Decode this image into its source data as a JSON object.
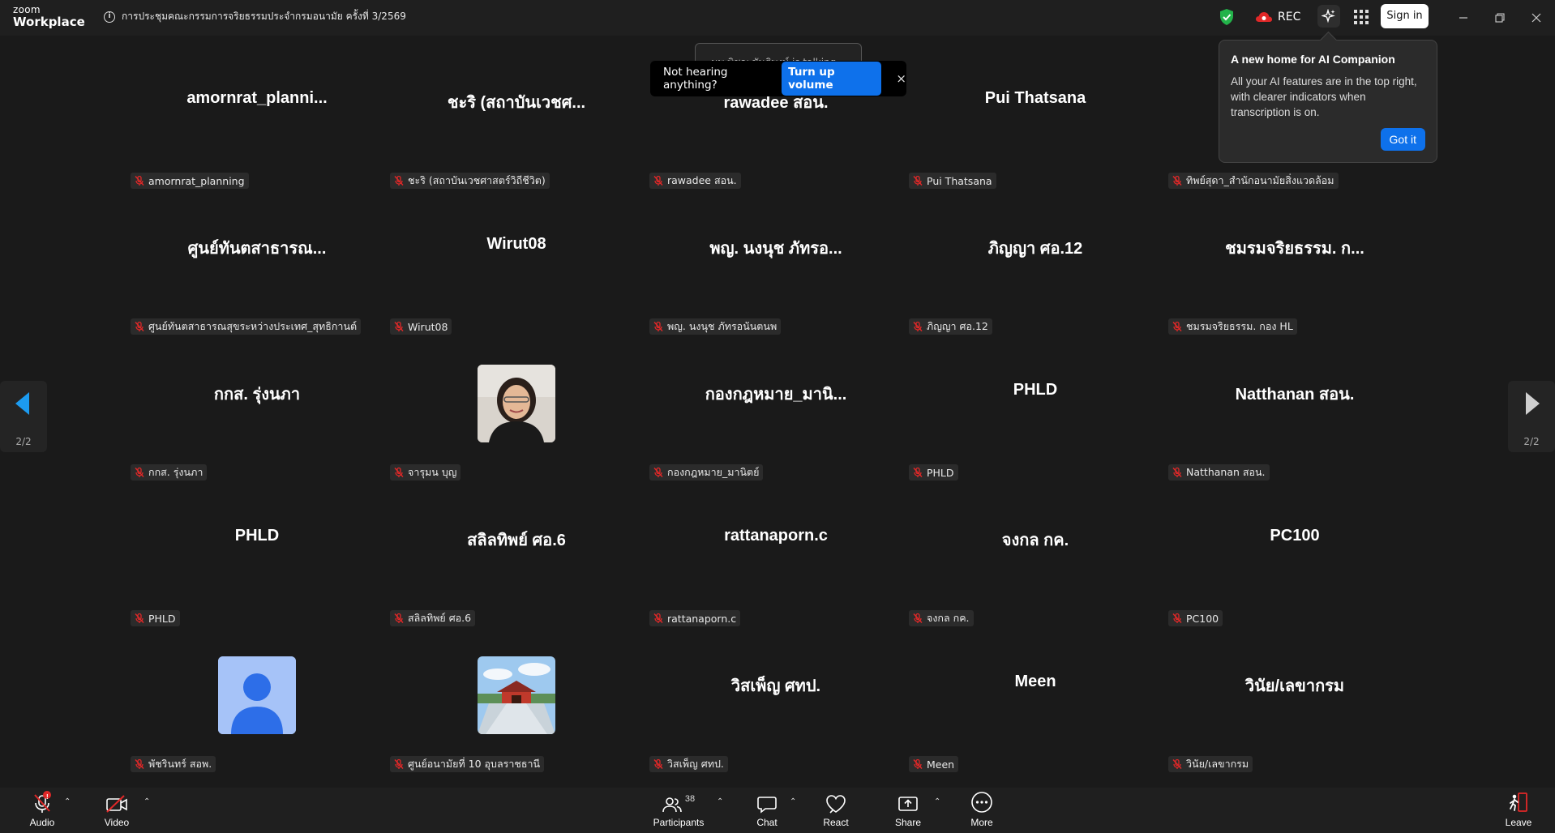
{
  "app": {
    "brand_top": "zoom",
    "brand_bottom": "Workplace"
  },
  "meeting": {
    "title": "การประชุมคณะกรรมการจริยธรรมประจำกรมอนามัย ครั้งที่ 3/2569"
  },
  "header": {
    "rec_label": "REC",
    "sign_in": "Sign in"
  },
  "talking_indicator": "นพ.พิชญ ขันติพงษ์ is talking...",
  "toast": {
    "message": "Not hearing anything?",
    "action": "Turn up volume",
    "close": "×"
  },
  "popover": {
    "title": "A new home for AI Companion",
    "body": "All your AI features are in the top right, with clearer indicators when transcription is on.",
    "button": "Got it"
  },
  "pagination": {
    "left_count": "2/2",
    "right_count": "2/2"
  },
  "participants_grid": [
    {
      "display": "amornrat_planni...",
      "label": "amornrat_planning",
      "avatar": ""
    },
    {
      "display": "ชะริ (สถาบันเวชศ...",
      "label": "ชะริ (สถาบันเวชศาสตร์วิถีชีวิต)",
      "avatar": ""
    },
    {
      "display": "rawadee  สอน.",
      "label": "rawadee  สอน.",
      "avatar": ""
    },
    {
      "display": "Pui Thatsana",
      "label": "Pui Thatsana",
      "avatar": ""
    },
    {
      "display": "",
      "label": "ทิพย์สุดา_สำนักอนามัยสิ่งแวดล้อม",
      "avatar": ""
    },
    {
      "display": "ศูนย์ทันตสาธารณ...",
      "label": "ศูนย์ทันตสาธารณสุขระหว่างประเทศ_สุทธิกานต์",
      "avatar": ""
    },
    {
      "display": "Wirut08",
      "label": "Wirut08",
      "avatar": ""
    },
    {
      "display": "พญ. นงนุช ภัทรอ...",
      "label": "พญ. นงนุช ภัทรอนันตนพ",
      "avatar": ""
    },
    {
      "display": "ภิญญา ศอ.12",
      "label": "ภิญญา ศอ.12",
      "avatar": ""
    },
    {
      "display": "ชมรมจริยธรรม. ก...",
      "label": "ชมรมจริยธรรม. กอง HL",
      "avatar": ""
    },
    {
      "display": "กกส. รุ่งนภา",
      "label": "กกส. รุ่งนภา",
      "avatar": ""
    },
    {
      "display": "",
      "label": "จารุมน บุญ",
      "avatar": "photo"
    },
    {
      "display": "กองกฎหมาย_มานิ...",
      "label": "กองกฎหมาย_มานิตย์",
      "avatar": ""
    },
    {
      "display": "PHLD",
      "label": "PHLD",
      "avatar": ""
    },
    {
      "display": "Natthanan สอน.",
      "label": "Natthanan สอน.",
      "avatar": ""
    },
    {
      "display": "PHLD",
      "label": "PHLD",
      "avatar": ""
    },
    {
      "display": "สลิลทิพย์ ศอ.6",
      "label": "สลิลทิพย์ ศอ.6",
      "avatar": ""
    },
    {
      "display": "rattanaporn.c",
      "label": "rattanaporn.c",
      "avatar": ""
    },
    {
      "display": "จงกล กค.",
      "label": "จงกล กค.",
      "avatar": ""
    },
    {
      "display": "PC100",
      "label": "PC100",
      "avatar": ""
    },
    {
      "display": "",
      "label": "พัชรินทร์ สอพ.",
      "avatar": "default"
    },
    {
      "display": "",
      "label": "ศูนย์อนามัยที่ 10 อุบลราชธานี",
      "avatar": "temple"
    },
    {
      "display": "วิสเพ็ญ ศทป.",
      "label": "วิสเพ็ญ ศทป.",
      "avatar": ""
    },
    {
      "display": "Meen",
      "label": "Meen",
      "avatar": ""
    },
    {
      "display": "วินัย/เลขากรม",
      "label": "วินัย/เลขากรม",
      "avatar": ""
    }
  ],
  "toolbar": {
    "audio": "Audio",
    "audio_badge": "!",
    "video": "Video",
    "participants": "Participants",
    "participants_count": "38",
    "chat": "Chat",
    "react": "React",
    "share": "Share",
    "more": "More",
    "leave": "Leave"
  },
  "colors": {
    "accent": "#0e71eb",
    "mute_red": "#e02828",
    "background": "#1a1a1a",
    "shield_green": "#23b34a"
  }
}
